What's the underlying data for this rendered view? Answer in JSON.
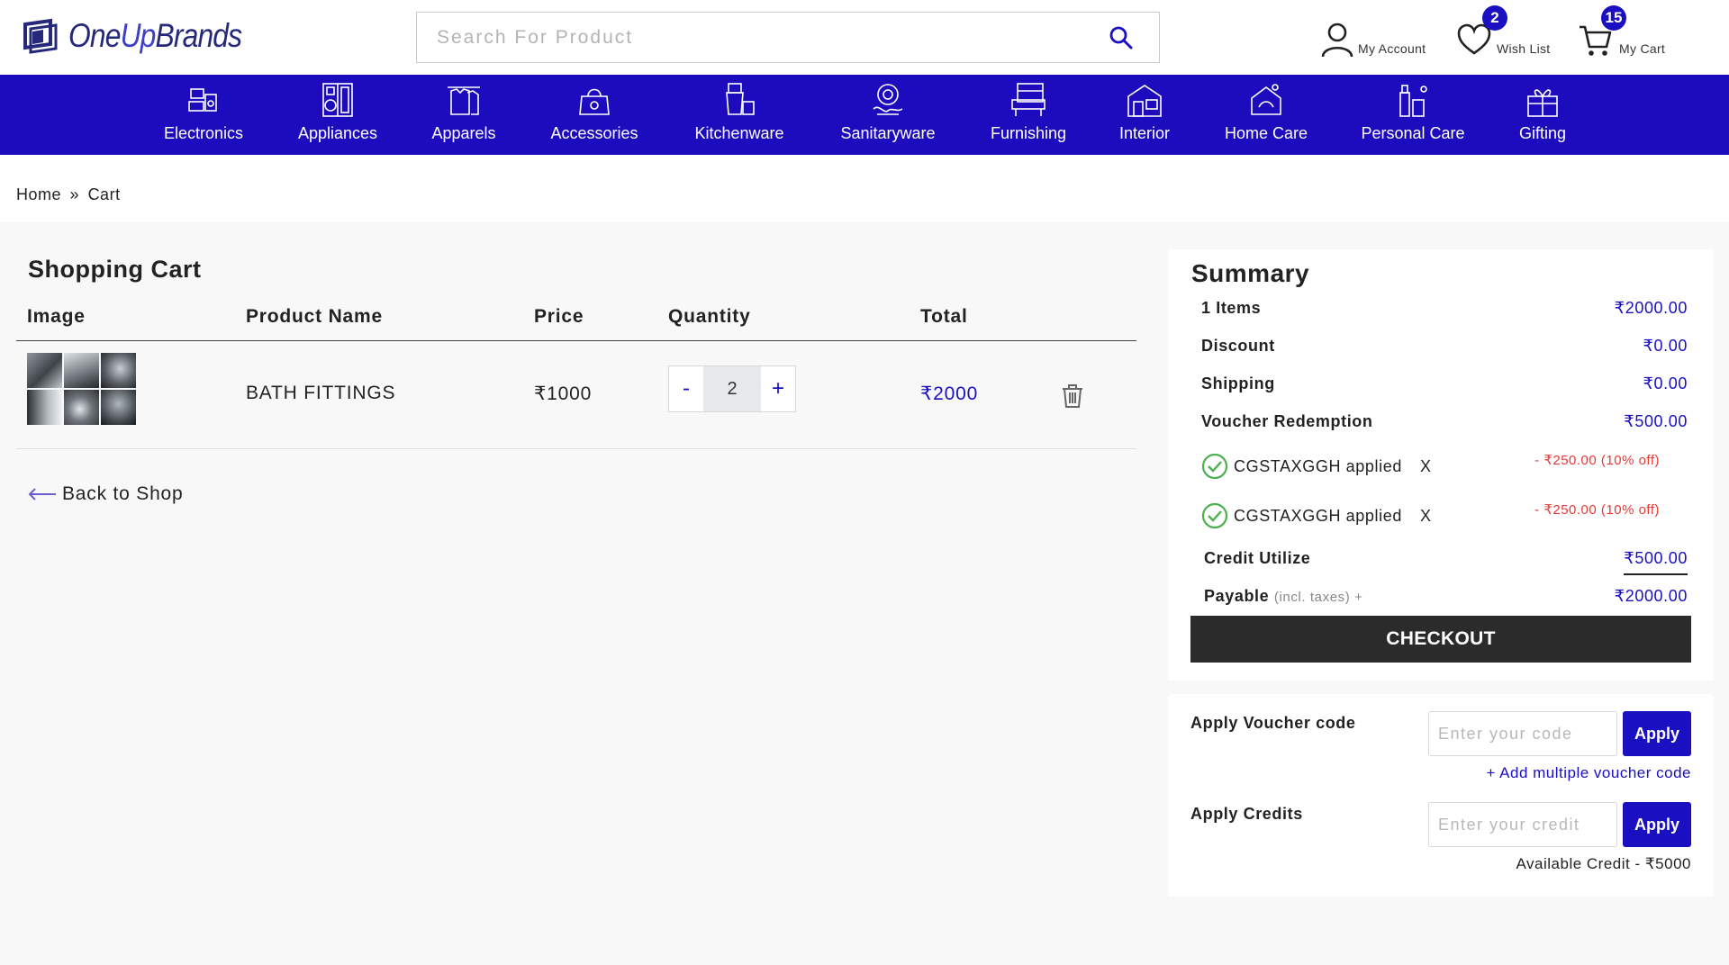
{
  "brand": {
    "logo_text_a": "One",
    "logo_text_b": "Up",
    "logo_text_c": "Brands"
  },
  "search": {
    "placeholder": "Search For Product"
  },
  "header": {
    "account_label": "My Account",
    "wishlist_label": "Wish List",
    "wishlist_count": "2",
    "cart_label": "My Cart",
    "cart_count": "15"
  },
  "categories": [
    {
      "label": "Electronics",
      "icon": "electronics-icon"
    },
    {
      "label": "Appliances",
      "icon": "appliances-icon"
    },
    {
      "label": "Apparels",
      "icon": "apparels-icon"
    },
    {
      "label": "Accessories",
      "icon": "accessories-icon"
    },
    {
      "label": "Kitchenware",
      "icon": "kitchenware-icon"
    },
    {
      "label": "Sanitaryware",
      "icon": "sanitaryware-icon"
    },
    {
      "label": "Furnishing",
      "icon": "furnishing-icon"
    },
    {
      "label": "Interior",
      "icon": "interior-icon"
    },
    {
      "label": "Home Care",
      "icon": "home-care-icon"
    },
    {
      "label": "Personal Care",
      "icon": "personal-care-icon"
    },
    {
      "label": "Gifting",
      "icon": "gifting-icon"
    }
  ],
  "breadcrumb": {
    "home": "Home",
    "separator": "»",
    "current": "Cart"
  },
  "cart": {
    "title": "Shopping Cart",
    "columns": {
      "image": "Image",
      "product": "Product Name",
      "price": "Price",
      "quantity": "Quantity",
      "total": "Total"
    },
    "items": [
      {
        "name": "BATH FITTINGS",
        "price": "₹1000",
        "quantity": "2",
        "total": "₹2000"
      }
    ],
    "qty_minus": "-",
    "qty_plus": "+",
    "back_label": "Back to Shop"
  },
  "summary": {
    "title": "Summary",
    "items_label": "1 Items",
    "items_value": "₹2000.00",
    "discount_label": "Discount",
    "discount_value": "₹0.00",
    "shipping_label": "Shipping",
    "shipping_value": "₹0.00",
    "voucher_label": "Voucher Redemption",
    "voucher_value": "₹500.00",
    "vouchers": [
      {
        "text": "CGSTAXGGH applied",
        "remove": "X",
        "off": "- ₹250.00 (10% off)"
      },
      {
        "text": "CGSTAXGGH applied",
        "remove": "X",
        "off": "- ₹250.00 (10% off)"
      }
    ],
    "credit_label": "Credit Utilize",
    "credit_value": "₹500.00",
    "payable_label": "Payable",
    "payable_note": "(incl. taxes) +",
    "payable_value": "₹2000.00",
    "checkout_label": "CHECKOUT"
  },
  "apply": {
    "voucher_label": "Apply Voucher code",
    "voucher_placeholder": "Enter your code",
    "voucher_button": "Apply",
    "add_multiple": "+ Add multiple voucher code",
    "credits_label": "Apply Credits",
    "credits_placeholder": "Enter your credit",
    "credits_button": "Apply",
    "available_credit": "Available Credit - ₹5000"
  },
  "colors": {
    "brand": "#1c0cbd",
    "accent": "#1a0fc1",
    "danger": "#e53935",
    "success": "#4caf50",
    "checkout": "#2b2b2b"
  }
}
